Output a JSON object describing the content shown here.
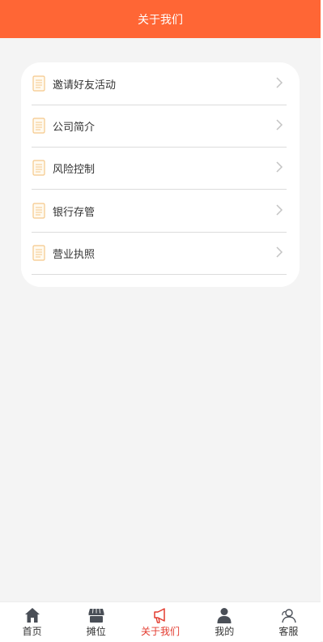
{
  "header": {
    "title": "关于我们"
  },
  "menu": {
    "items": [
      {
        "label": "邀请好友活动"
      },
      {
        "label": "公司简介"
      },
      {
        "label": "风险控制"
      },
      {
        "label": "银行存管"
      },
      {
        "label": "营业执照"
      }
    ]
  },
  "tabbar": {
    "tabs": [
      {
        "label": "首页",
        "icon": "home-icon"
      },
      {
        "label": "摊位",
        "icon": "store-icon"
      },
      {
        "label": "关于我们",
        "icon": "megaphone-icon",
        "active": true
      },
      {
        "label": "我的",
        "icon": "user-icon"
      },
      {
        "label": "客服",
        "icon": "customer-service-icon"
      }
    ]
  },
  "colors": {
    "header_bg": "#ff6635",
    "active_tab": "#e33b2f",
    "icon_doc": "#f5c88a"
  }
}
